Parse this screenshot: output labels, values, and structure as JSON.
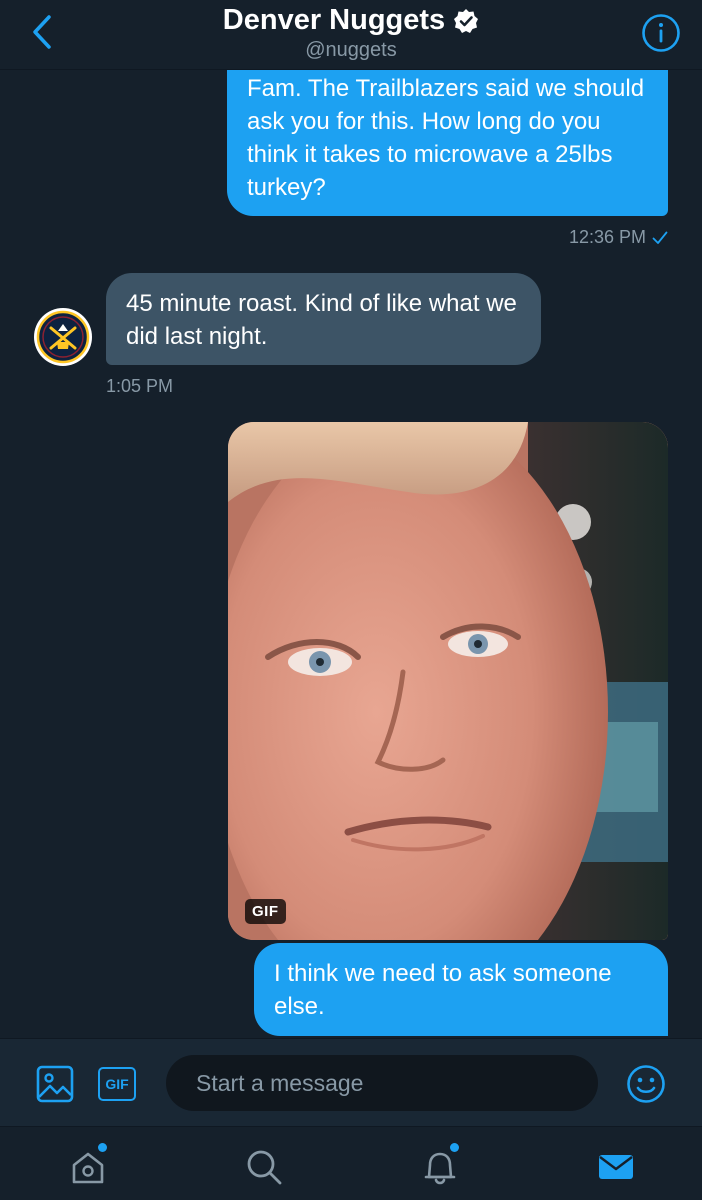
{
  "header": {
    "title": "Denver Nuggets",
    "handle": "@nuggets"
  },
  "messages": [
    {
      "direction": "outgoing",
      "text": "Fam. The Trailblazers said we should ask you for this. How long do you think it takes to microwave a 25lbs turkey?"
    },
    {
      "direction": "outgoing",
      "timestamp": "12:36 PM"
    },
    {
      "direction": "incoming",
      "text": "45 minute roast. Kind of like what we did last night.",
      "timestamp": "1:05 PM"
    },
    {
      "direction": "outgoing",
      "type": "gif",
      "badge": "GIF"
    },
    {
      "direction": "outgoing",
      "text": "I think we need to ask someone else."
    }
  ],
  "composer": {
    "gif_label": "GIF",
    "placeholder": "Start a message"
  },
  "tabs": [
    "home-icon",
    "search-icon",
    "notifications-icon",
    "messages-icon"
  ],
  "colors": {
    "background": "#15202b",
    "accent": "#1da1f2",
    "incoming_bubble": "#3d5466",
    "muted": "#8899a6"
  }
}
